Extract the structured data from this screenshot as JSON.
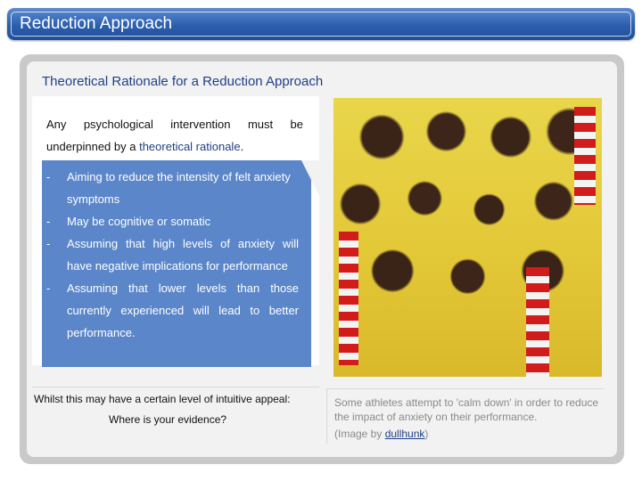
{
  "header": {
    "title": "Reduction Approach"
  },
  "slide": {
    "heading": "Theoretical Rationale for a Reduction Approach",
    "intro": {
      "words_line1": [
        "Any",
        "psychological",
        "intervention",
        "must",
        "be"
      ],
      "line2_prefix": "underpinned by a ",
      "line2_highlight": "theoretical rationale",
      "line2_suffix": "."
    },
    "bullet_marker": "-",
    "bullets": [
      "Aiming to reduce the intensity of felt anxiety symptoms",
      "May be cognitive or somatic",
      "Assuming that high levels of anxiety will have negative implications for performance",
      "Assuming that lower levels than those currently experienced will lead to better performance."
    ],
    "appeal_text": "Whilst this may have a certain level of intuitive appeal:",
    "evidence_question": "Where is your evidence?",
    "caption": {
      "text": "Some athletes attempt to 'calm down' in order to reduce the impact of anxiety on their performance.",
      "credit_prefix": "(Image by ",
      "credit_link": "dullhunk",
      "credit_suffix": ")"
    }
  },
  "colors": {
    "title_bar": "#2b5fae",
    "heading": "#1f3f86",
    "bullet_box": "#5b86c9",
    "caption_text": "#8a8a8a"
  }
}
